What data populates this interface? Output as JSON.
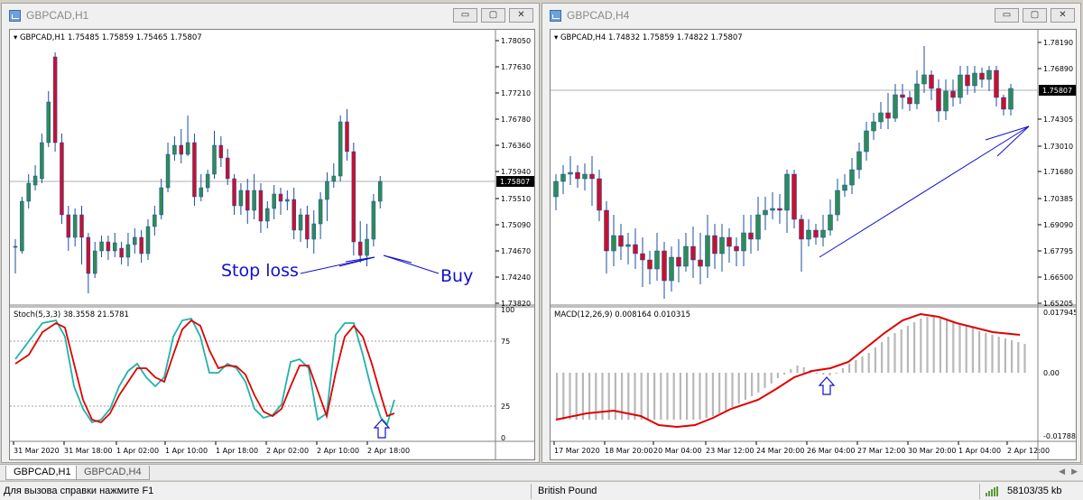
{
  "left_window": {
    "title": "GBPCAD,H1",
    "info": "GBPCAD,H1  1.75485 1.75859 1.75465 1.75807",
    "price_ticks": [
      "1.78050",
      "1.77630",
      "1.77210",
      "1.76780",
      "1.76360",
      "1.75940",
      "1.75510",
      "1.75090",
      "1.74670",
      "1.74240",
      "1.73820"
    ],
    "current_price": "1.75807",
    "indicator_label": "Stoch(5,3,3) 38.3558 21.5781",
    "indicator_ticks": [
      "100",
      "75",
      "25",
      "0"
    ],
    "time_labels": [
      "31 Mar 2020",
      "31 Mar 18:00",
      "1 Apr 02:00",
      "1 Apr 10:00",
      "1 Apr 18:00",
      "2 Apr 02:00",
      "2 Apr 10:00",
      "2 Apr 18:00"
    ],
    "annotation_stop": "Stop loss",
    "annotation_buy": "Buy"
  },
  "right_window": {
    "title": "GBPCAD,H4",
    "info": "GBPCAD,H4  1.74832 1.75859 1.74822 1.75807",
    "price_ticks": [
      "1.78190",
      "1.76890",
      "1.75807",
      "1.74305",
      "1.73010",
      "1.71680",
      "1.70385",
      "1.69090",
      "1.67795",
      "1.66500",
      "1.65205"
    ],
    "current_price": "1.75807",
    "indicator_label": "MACD(12,26,9) 0.008164 0.010315",
    "indicator_ticks": [
      "0.017945",
      "0.00",
      "-0.017881"
    ],
    "time_labels": [
      "17 Mar 2020",
      "18 Mar 20:00",
      "20 Mar 04:00",
      "23 Mar 12:00",
      "24 Mar 20:00",
      "26 Mar 04:00",
      "27 Mar 12:00",
      "30 Mar 20:00",
      "1 Apr 04:00",
      "2 Apr 12:00"
    ]
  },
  "window_buttons": {
    "minimize": "▭",
    "restore": "▢",
    "close": "✕"
  },
  "tabs": [
    "GBPCAD,H1",
    "GBPCAD,H4"
  ],
  "status": {
    "help": "Для вызова справки нажмите F1",
    "instrument": "British Pound",
    "traffic": "58103/35 kb"
  },
  "colors": {
    "bull": "#2e8b57",
    "bear": "#c8102e",
    "stoch_main": "#20b2aa",
    "stoch_signal": "#e00000",
    "macd_hist": "#b8b8b8",
    "macd_signal": "#e00000",
    "annotation": "#1010d0"
  }
}
